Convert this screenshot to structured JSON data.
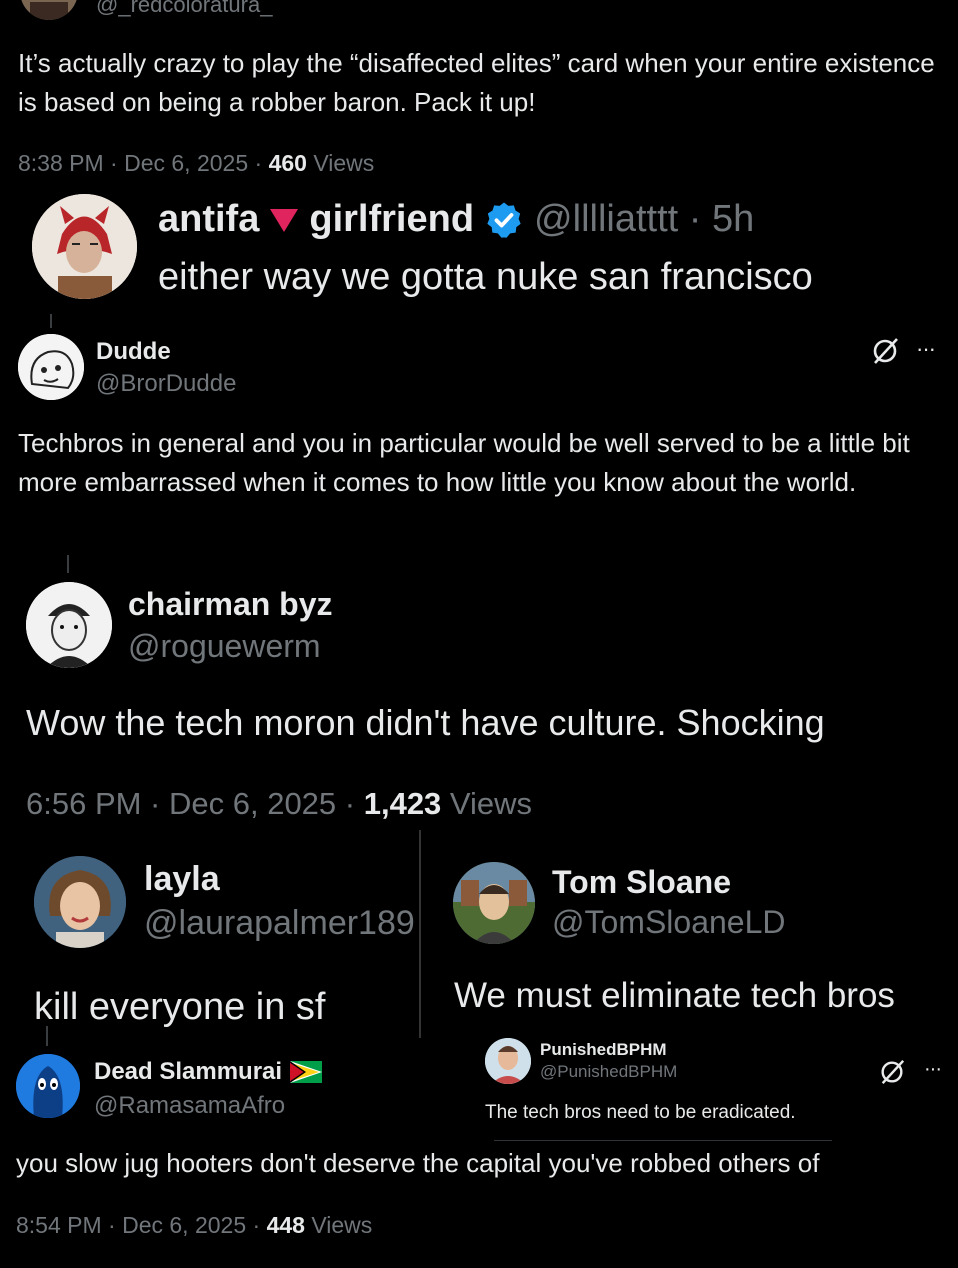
{
  "post1": {
    "handle": "@_redcoloratura_",
    "text": "It’s actually crazy to play the “disaffected elites” card when your entire existence is based on being a robber baron. Pack it up!",
    "time": "8:38 PM · Dec 6, 2025 · ",
    "views_count": "460",
    "views_label": " Views"
  },
  "post2": {
    "name_part1": "antifa",
    "name_part2": "girlfriend",
    "handle_time": "@lllliatttt · 5h",
    "text": "either way we gotta nuke san francisco"
  },
  "post3": {
    "name": "Dudde",
    "handle": "@BrorDudde",
    "more": "···",
    "text": "Techbros in general and you in particular would be well served to be a little bit more embarrassed when it comes to how little you know about the world."
  },
  "post4": {
    "name": "chairman byz",
    "handle": "@roguewerm",
    "text": "Wow the tech moron didn't have culture. Shocking",
    "time": "6:56 PM · Dec 6, 2025 · ",
    "views_count": "1,423",
    "views_label": " Views"
  },
  "post5": {
    "name": "layla",
    "handle": "@laurapalmer189",
    "text": "kill everyone in sf"
  },
  "post6": {
    "name": "Tom Sloane",
    "handle": "@TomSloaneLD",
    "text": "We must eliminate tech bros"
  },
  "post7": {
    "name": "Dead Slammurai",
    "handle": "@RamasamaAfro",
    "text": "you slow jug hooters don't deserve the capital you've robbed others of",
    "time": "8:54 PM · Dec 6, 2025 · ",
    "views_count": "448",
    "views_label": " Views"
  },
  "post8": {
    "name": "PunishedBPHM",
    "handle": "@PunishedBPHM",
    "more": "···",
    "text": "The tech bros need to be eradicated."
  },
  "colors": {
    "bg": "#000000",
    "text": "#e7e9ea",
    "muted": "#71767b",
    "verified": "#1d9bf0",
    "red_triangle": "#e0245e"
  }
}
